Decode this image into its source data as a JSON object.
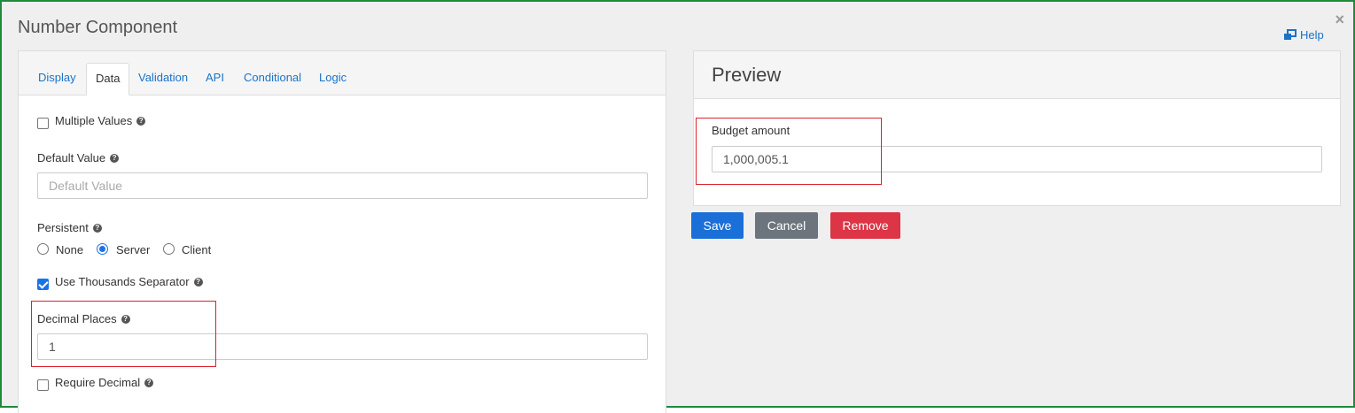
{
  "modal": {
    "title": "Number Component",
    "close_label": "×",
    "help_label": "Help"
  },
  "tabs": [
    {
      "label": "Display",
      "active": false
    },
    {
      "label": "Data",
      "active": true
    },
    {
      "label": "Validation",
      "active": false
    },
    {
      "label": "API",
      "active": false
    },
    {
      "label": "Conditional",
      "active": false
    },
    {
      "label": "Logic",
      "active": false
    }
  ],
  "form": {
    "multiple_values": {
      "label": "Multiple Values",
      "checked": false
    },
    "default_value": {
      "label": "Default Value",
      "placeholder": "Default Value",
      "value": ""
    },
    "persistent": {
      "label": "Persistent",
      "options": [
        {
          "label": "None",
          "checked": false
        },
        {
          "label": "Server",
          "checked": true
        },
        {
          "label": "Client",
          "checked": false
        }
      ]
    },
    "thousands_separator": {
      "label": "Use Thousands Separator",
      "checked": true
    },
    "decimal_places": {
      "label": "Decimal Places",
      "value": "1"
    },
    "require_decimal": {
      "label": "Require Decimal",
      "checked": false
    }
  },
  "preview": {
    "title": "Preview",
    "field_label": "Budget amount",
    "field_value": "1,000,005.1"
  },
  "actions": {
    "save_label": "Save",
    "cancel_label": "Cancel",
    "remove_label": "Remove"
  },
  "colors": {
    "frame_border": "#1e8a3c",
    "link": "#1a73c8",
    "highlight": "#d9232d",
    "save": "#1a6fd8",
    "cancel": "#6c757d",
    "remove": "#dc3545"
  },
  "icons": {
    "help": "external-window-icon",
    "tooltip": "question-circle-icon",
    "close": "close-icon"
  }
}
